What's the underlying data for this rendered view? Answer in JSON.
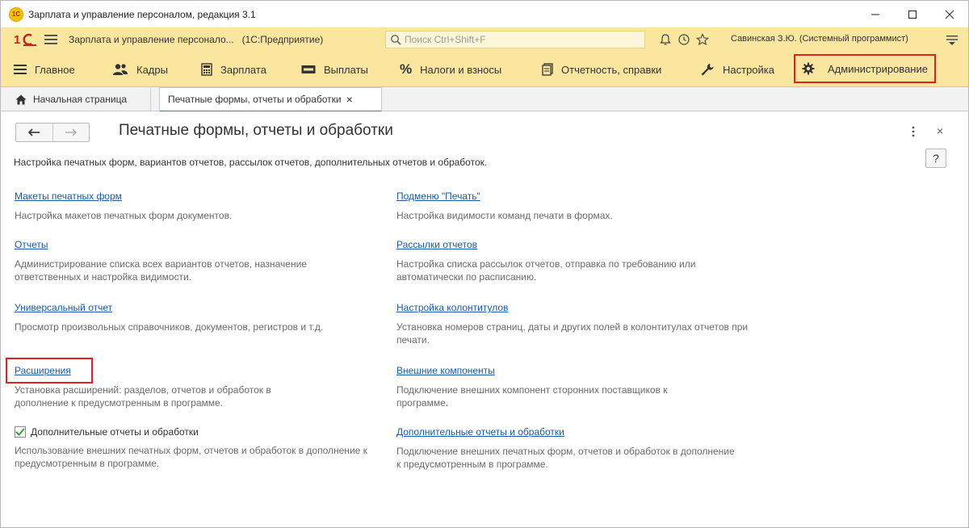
{
  "window": {
    "title": "Зарплата и управление персоналом, редакция 3.1",
    "logo_text": "1С"
  },
  "toolbar": {
    "app_name": "Зарплата и управление персонало...",
    "mode": "(1С:Предприятие)",
    "search_placeholder": "Поиск Ctrl+Shift+F",
    "user": "Савинская З.Ю. (Системный программист)"
  },
  "sections": [
    {
      "label": "Главное",
      "icon": "menu-icon"
    },
    {
      "label": "Кадры",
      "icon": "people-icon"
    },
    {
      "label": "Зарплата",
      "icon": "calculator-icon"
    },
    {
      "label": "Выплаты",
      "icon": "money-icon"
    },
    {
      "label": "Налоги и взносы",
      "icon": "percent-icon"
    },
    {
      "label": "Отчетность, справки",
      "icon": "report-icon"
    },
    {
      "label": "Настройка",
      "icon": "wrench-icon"
    },
    {
      "label": "Администрирование",
      "icon": "gear-icon"
    }
  ],
  "tabs": {
    "home": "Начальная страница",
    "active": "Печатные формы, отчеты и обработки",
    "close": "×"
  },
  "page": {
    "title": "Печатные формы, отчеты и обработки",
    "description": "Настройка печатных форм, вариантов отчетов, рассылок отчетов, дополнительных отчетов и обработок.",
    "help": "?",
    "close": "×"
  },
  "left": [
    {
      "link": "Макеты печатных форм",
      "desc": "Настройка макетов печатных форм документов."
    },
    {
      "link": "Отчеты",
      "desc": "Администрирование списка всех вариантов отчетов, назначение ответственных и настройка видимости."
    },
    {
      "link": "Универсальный отчет",
      "desc": "Просмотр произвольных справочников, документов, регистров и т.д."
    },
    {
      "link": "Расширения",
      "desc": "Установка расширений: разделов, отчетов и обработок в дополнение к предусмотренным в программе."
    },
    {
      "checkbox": "Дополнительные отчеты и обработки",
      "checked": true,
      "desc": "Использование внешних печатных форм, отчетов и обработок в дополнение к предусмотренным в программе."
    }
  ],
  "right": [
    {
      "link": "Подменю \"Печать\"",
      "desc": "Настройка видимости команд печати в формах."
    },
    {
      "link": "Рассылки отчетов",
      "desc": "Настройка списка рассылок отчетов, отправка по требованию или автоматически по расписанию."
    },
    {
      "link": "Настройка колонтитулов",
      "desc": "Установка номеров страниц, даты и других полей в колонтитулах отчетов при печати."
    },
    {
      "link": "Внешние компоненты",
      "desc": "Подключение внешних компонент сторонних поставщиков к программе."
    },
    {
      "link": "Дополнительные отчеты и обработки",
      "desc": "Подключение внешних печатных форм, отчетов и обработок в дополнение к предусмотренным в программе."
    }
  ],
  "colors": {
    "toolbar_bg": "#fbe6a0",
    "highlight": "#e32020",
    "link": "#1a5aa8",
    "active_tab_underline": "#3d9a3d"
  }
}
